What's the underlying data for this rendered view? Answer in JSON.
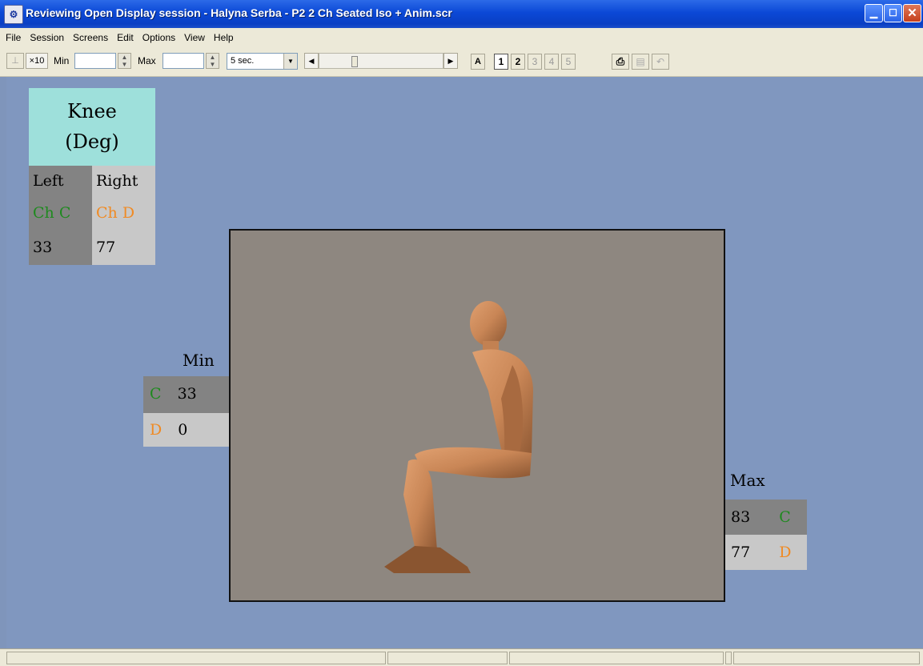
{
  "window": {
    "title": "Reviewing Open Display session - Halyna Serba - P2 2 Ch Seated Iso + Anim.scr",
    "app_icon": "app-icon",
    "controls": [
      "minimize-icon",
      "maximize-icon",
      "close-icon"
    ]
  },
  "menu": [
    "File",
    "Session",
    "Screens",
    "Edit",
    "Options",
    "View",
    "Help"
  ],
  "toolbar": {
    "x10_label": "×10",
    "min_label": "Min",
    "min_value": "",
    "max_label": "Max",
    "max_value": "",
    "duration": "5 sec.",
    "auto_label": "A",
    "pages": [
      "1",
      "2",
      "3",
      "4",
      "5"
    ],
    "active_pages": [
      "1",
      "2"
    ]
  },
  "knee": {
    "title_line1": "Knee",
    "title_line2": "(Deg)",
    "left_label": "Left",
    "right_label": "Right",
    "left_channel": "Ch C",
    "right_channel": "Ch D",
    "left_value": "33",
    "right_value": "77"
  },
  "min_panel": {
    "label": "Min",
    "rows": [
      {
        "channel": "C",
        "value": "33"
      },
      {
        "channel": "D",
        "value": "0"
      }
    ]
  },
  "max_panel": {
    "label": "Max",
    "rows": [
      {
        "value": "83",
        "channel": "C"
      },
      {
        "value": "77",
        "channel": "D"
      }
    ]
  },
  "colors": {
    "channel_c": "#1f8a1f",
    "channel_d": "#f08a23",
    "workspace": "#8097bf",
    "knee_header": "#9ee0db"
  }
}
